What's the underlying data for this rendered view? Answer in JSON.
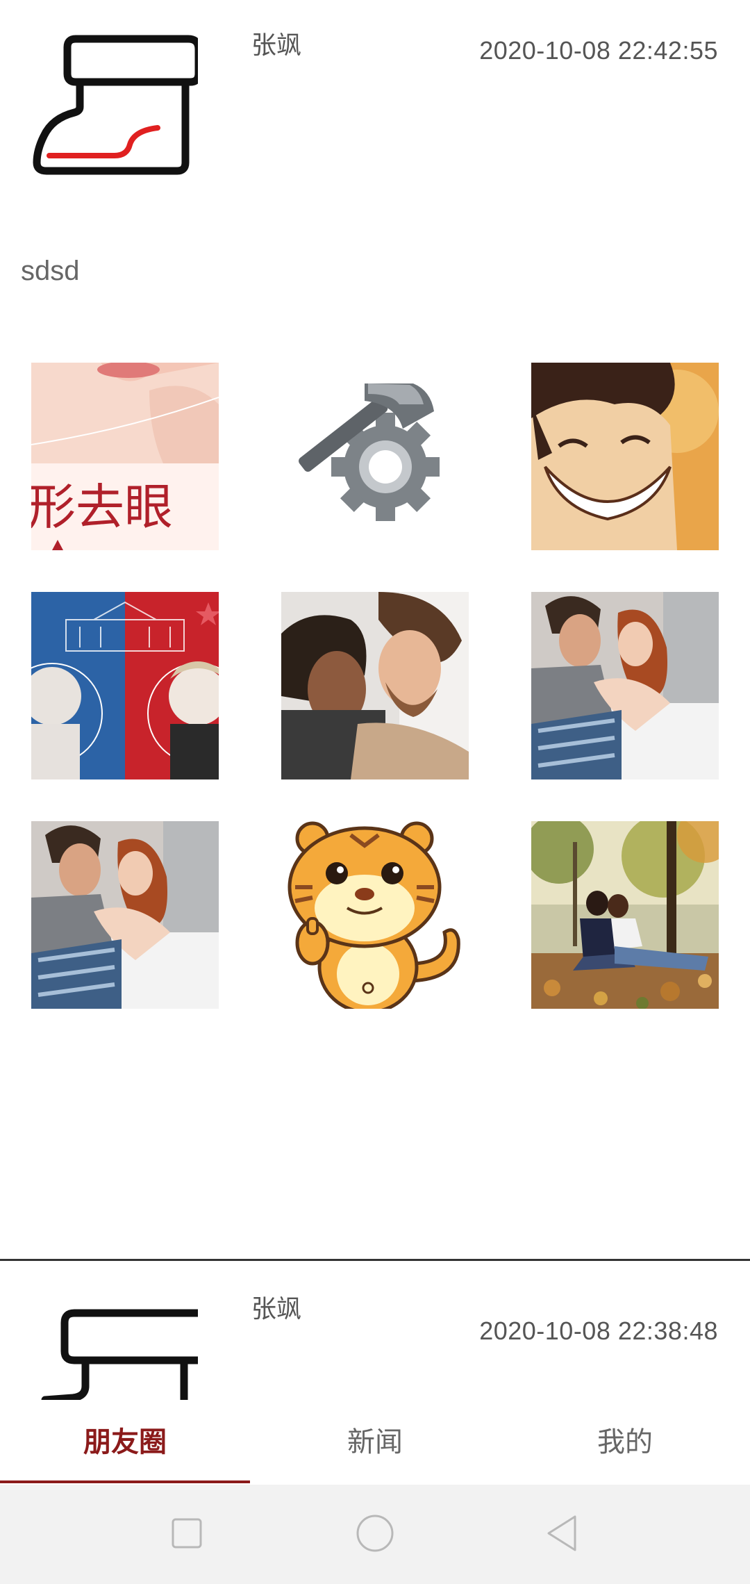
{
  "posts": [
    {
      "author": "张飒",
      "time": "2020-10-08 22:42:55",
      "text": "sdsd",
      "images": [
        {
          "subject": "chin-cosmetic-ad",
          "caption": "形去眼"
        },
        {
          "subject": "hammer-gear-icon"
        },
        {
          "subject": "smiling-anime-boy"
        },
        {
          "subject": "election-portraits"
        },
        {
          "subject": "couple-photo"
        },
        {
          "subject": "couple-embrace-photo"
        },
        {
          "subject": "couple-embrace-photo"
        },
        {
          "subject": "cartoon-tiger-thumbs-up"
        },
        {
          "subject": "couple-park-autumn"
        }
      ]
    },
    {
      "author": "张飒",
      "time": "2020-10-08 22:38:48"
    }
  ],
  "tabs": [
    {
      "label": "朋友圈",
      "active": true
    },
    {
      "label": "新闻",
      "active": false
    },
    {
      "label": "我的",
      "active": false
    }
  ],
  "nav": {
    "icons": [
      "square-icon",
      "circle-icon",
      "triangle-back-icon"
    ]
  },
  "colors": {
    "accent": "#8b1a1a",
    "boot_red": "#e02020"
  }
}
